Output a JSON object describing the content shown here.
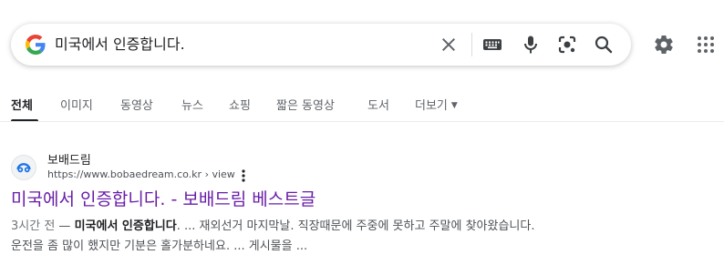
{
  "search": {
    "query": "미국에서 인증합니다."
  },
  "tabs": [
    {
      "label": "전체",
      "active": true
    },
    {
      "label": "이미지"
    },
    {
      "label": "동영상"
    },
    {
      "label": "뉴스"
    },
    {
      "label": "쇼핑"
    },
    {
      "label": "짧은 동영상"
    },
    {
      "label": "도서"
    },
    {
      "label": "더보기"
    }
  ],
  "result": {
    "site_name": "보배드림",
    "url": "https://www.bobaedream.co.kr › view",
    "title": "미국에서 인증합니다. - 보배드림 베스트글",
    "snippet_time": "3시간 전",
    "snippet_dash": " — ",
    "snippet_bold": "미국에서 인증합니다",
    "snippet_line1_rest": ". ... 재외선거 마지막날. 직장때문에 주중에 못하고 주말에 찾아왔습니다.",
    "snippet_line2": "운전을 좀 많이 했지만 기분은 홀가분하네요. ... 게시물을 ..."
  },
  "colors": {
    "title_visited": "#681da8",
    "snippet_text": "#4d5156",
    "icon_gray": "#5f6368"
  }
}
